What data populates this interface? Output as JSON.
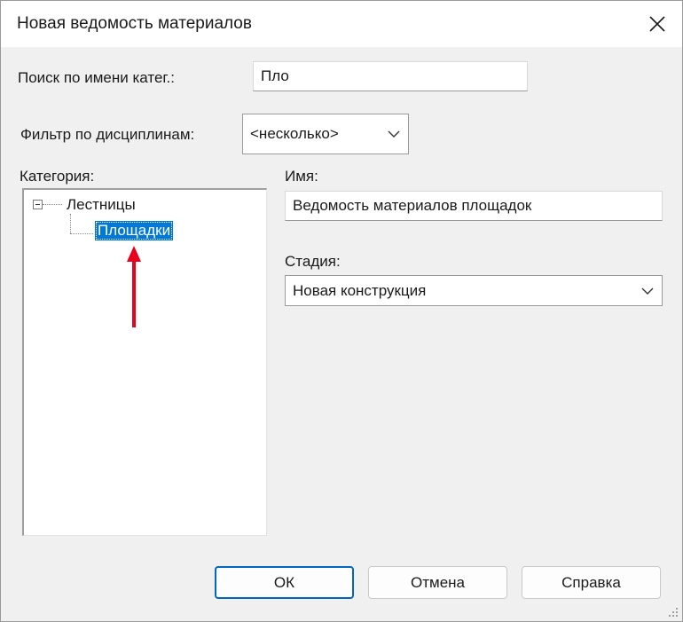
{
  "dialog": {
    "title": "Новая ведомость материалов",
    "close_icon": "close-icon"
  },
  "search": {
    "label": "Поиск по имени катег.:",
    "value": "Пло"
  },
  "filter": {
    "label": "Фильтр по дисциплинам:",
    "value": "<несколько>"
  },
  "category": {
    "label": "Категория:",
    "tree": [
      {
        "label": "Лестницы",
        "expanded": true,
        "expander_symbol": "⊟",
        "children": [
          {
            "label": "Площадки",
            "selected": true
          }
        ]
      }
    ]
  },
  "name": {
    "label": "Имя:",
    "value": "Ведомость материалов площадок"
  },
  "phase": {
    "label": "Стадия:",
    "value": "Новая конструкция"
  },
  "buttons": {
    "ok": "ОК",
    "cancel": "Отмена",
    "help": "Справка"
  },
  "annotation": {
    "arrow_color": "#e8001c"
  },
  "colors": {
    "selection": "#0078d7",
    "dialog_bg": "#f0f0f0",
    "default_button_border": "#0067c0"
  }
}
